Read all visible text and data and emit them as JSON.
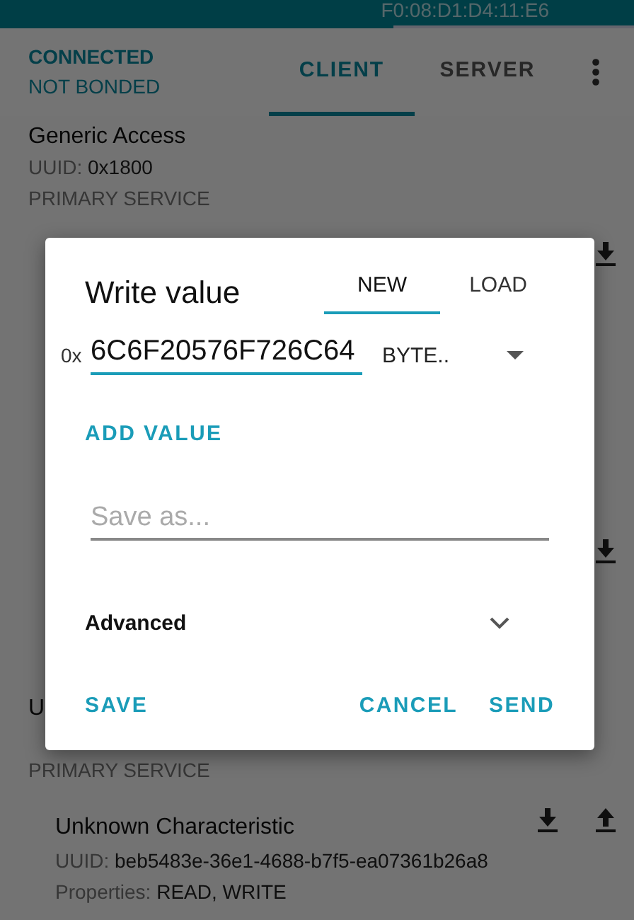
{
  "device_address": "F0:08:D1:D4:11:E6",
  "connection": {
    "state": "CONNECTED",
    "bond": "NOT BONDED"
  },
  "tabs": [
    {
      "label": "CLIENT",
      "selected": true
    },
    {
      "label": "SERVER",
      "selected": false
    }
  ],
  "services": [
    {
      "name": "Generic Access",
      "uuid_label": "UUID:",
      "uuid": "0x1800",
      "type": "PRIMARY SERVICE",
      "characteristics": [
        {
          "actions": [
            {
              "kind": "read"
            }
          ]
        },
        {
          "actions": [
            {
              "kind": "read"
            }
          ]
        }
      ]
    },
    {
      "name": "U",
      "type": "PRIMARY SERVICE",
      "characteristics": [
        {
          "name": "Unknown Characteristic",
          "uuid_label": "UUID:",
          "uuid": "beb5483e-36e1-4688-b7f5-ea07361b26a8",
          "properties_label": "Properties:",
          "properties": "READ, WRITE",
          "actions": [
            {
              "kind": "read"
            },
            {
              "kind": "write"
            }
          ]
        }
      ]
    }
  ],
  "dialog": {
    "title": "Write value",
    "tabs": [
      {
        "label": "NEW",
        "selected": true
      },
      {
        "label": "LOAD",
        "selected": false
      }
    ],
    "prefix": "0x",
    "value": "6C6F20576F726C64",
    "format": "BYTE..",
    "add_value": "ADD VALUE",
    "save_as": {
      "placeholder": "Save as..."
    },
    "advanced": {
      "label": "Advanced",
      "expanded": false
    },
    "buttons": [
      {
        "label": "SAVE",
        "kind": "left"
      },
      {
        "label": "CANCEL",
        "kind": "right"
      },
      {
        "label": "SEND",
        "kind": "right"
      }
    ]
  }
}
